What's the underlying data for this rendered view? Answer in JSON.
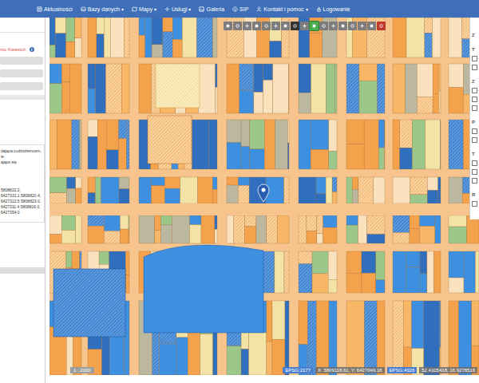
{
  "navbar": {
    "items": [
      {
        "label": "Aktualności"
      },
      {
        "label": "Bazy danych",
        "caret": "▾"
      },
      {
        "label": "Mapy",
        "caret": "▾"
      },
      {
        "label": "Usługi",
        "caret": "▾"
      },
      {
        "label": "Galeria"
      },
      {
        "label": "SIP"
      },
      {
        "label": "Kontakt i pomoc",
        "caret": "▾"
      },
      {
        "label": "Logowanie"
      }
    ]
  },
  "info_panel": {
    "label": "nto Kwasicz:",
    "info_icon": "i",
    "fields": [
      {
        "value": ""
      },
      {
        "value": ""
      },
      {
        "value": ""
      }
    ],
    "description": [
      "dająca cudzoziemcem,",
      "ie,",
      "ające się"
    ],
    "coordinates": [
      "5808822.2,",
      "6427331.1 5808820.4,",
      "6427322.5 5808823.0,",
      "6427311.4 5808816.0,",
      "6427354.0"
    ]
  },
  "map": {
    "toolbar": [
      {
        "selected": false,
        "color": "#7d7d7d"
      },
      {
        "selected": false,
        "color": "#7d7d7d"
      },
      {
        "selected": false,
        "color": "#7d7d7d"
      },
      {
        "selected": false,
        "color": "#7d7d7d"
      },
      {
        "selected": false,
        "color": "#7d7d7d"
      },
      {
        "selected": false,
        "color": "#7d7d7d"
      },
      {
        "selected": false,
        "color": "#7d7d7d"
      },
      {
        "selected": false,
        "color": "#333333"
      },
      {
        "selected": false,
        "color": "#7d7d7d"
      },
      {
        "selected": true,
        "color": "#4caf50"
      },
      {
        "selected": false,
        "color": "#7d7d7d"
      },
      {
        "selected": false,
        "color": "#7d7d7d"
      },
      {
        "selected": false,
        "color": "#7d7d7d"
      },
      {
        "selected": false,
        "color": "#7d7d7d"
      },
      {
        "selected": false,
        "color": "#7d7d7d"
      },
      {
        "selected": false,
        "color": "#7d7d7d"
      },
      {
        "selected": false,
        "color": "#c0392b"
      }
    ],
    "scale": "1 : 2000",
    "status": {
      "crs1": "EPSG:2177",
      "xy": "X: 5809118.61, Y: 6427049.16",
      "crs2": "EPSG:4326",
      "latlon": "52.4105418, 16.9278516"
    }
  },
  "layers_panel": {
    "sections": [
      {
        "title": "Z",
        "items": []
      },
      {
        "title": "T",
        "items": [
          {
            "checked": false
          },
          {
            "checked": false
          }
        ]
      },
      {
        "title": "Z",
        "items": [
          {
            "checked": false
          },
          {
            "checked": false
          },
          {
            "checked": false
          }
        ]
      },
      {
        "title": "P",
        "items": [
          {
            "checked": false
          },
          {
            "checked": false
          }
        ]
      },
      {
        "title": "T",
        "items": [
          {
            "checked": false
          },
          {
            "checked": false
          },
          {
            "checked": false
          }
        ]
      },
      {
        "title": "R",
        "items": [
          {
            "checked": false
          }
        ]
      }
    ]
  }
}
